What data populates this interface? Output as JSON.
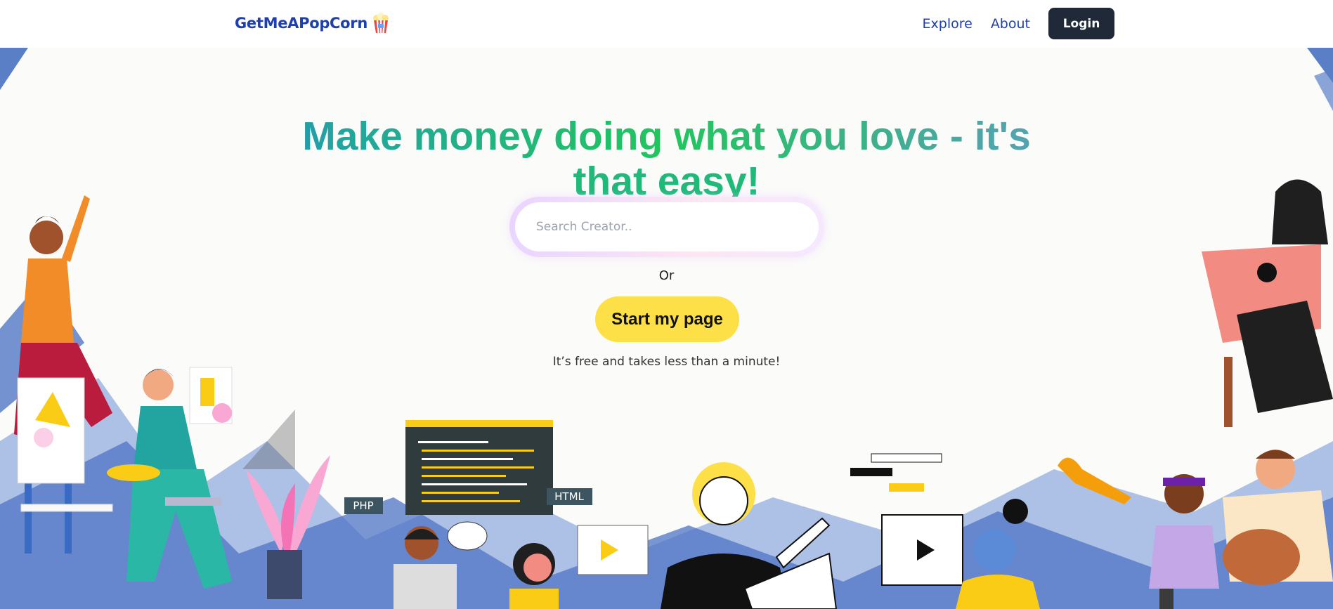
{
  "nav": {
    "brand": "GetMeAPopCorn",
    "links": [
      "Explore",
      "About"
    ],
    "login_label": "Login"
  },
  "hero": {
    "headline_line1": "Make money doing what you love - it's",
    "headline_line2": "that easy!",
    "search_placeholder": "Search Creator..",
    "or_text": "Or",
    "start_label": "Start my page",
    "free_text": "It’s free and takes less than a minute!"
  },
  "illustration": {
    "tags": [
      "PHP",
      "HTML"
    ]
  },
  "colors": {
    "brand": "#1e40af",
    "login_bg": "#1f2937",
    "start_bg": "#fde047",
    "headline_accent": "#1fb97a"
  }
}
